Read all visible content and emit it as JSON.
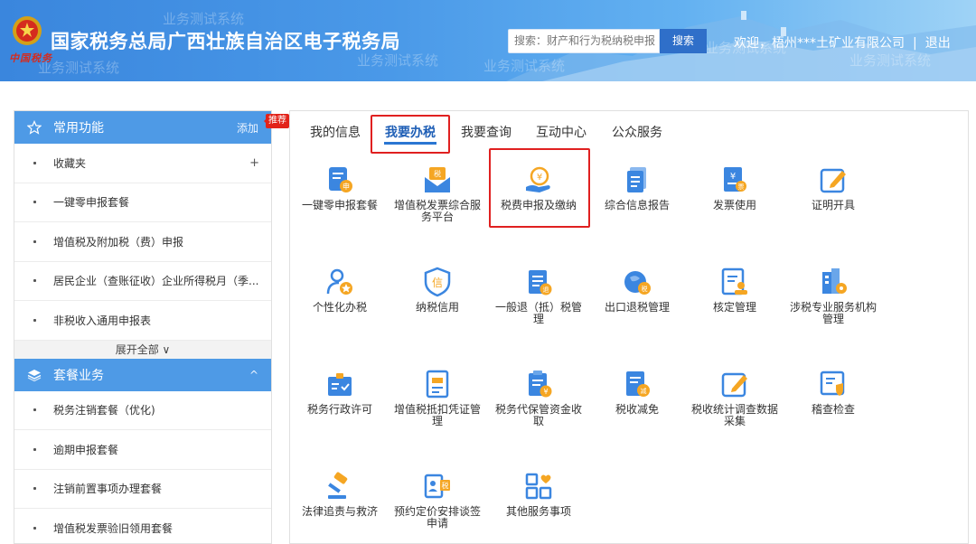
{
  "header": {
    "site_title": "国家税务总局广西壮族自治区电子税务局",
    "brand_sub": "中国税务",
    "watermark": "业务测试系统",
    "search_placeholder": "搜索：财产和行为税纳税申报",
    "search_button": "搜索",
    "welcome": "欢迎，",
    "company": "梧州***土矿业有限公司",
    "separator": "|",
    "logout": "退出"
  },
  "sidebar": {
    "common": {
      "title": "常用功能",
      "action": "添加",
      "badge": "推荐",
      "items": [
        {
          "label": "收藏夹",
          "extra": "+"
        },
        {
          "label": "一键零申报套餐"
        },
        {
          "label": "增值税及附加税（费）申报"
        },
        {
          "label": "居民企业（查账征收）企业所得税月（季..."
        },
        {
          "label": "非税收入通用申报表"
        }
      ],
      "expand": "展开全部 ∨"
    },
    "packages": {
      "title": "套餐业务",
      "collapse": "^",
      "items": [
        {
          "label": "税务注销套餐（优化)"
        },
        {
          "label": "逾期申报套餐"
        },
        {
          "label": "注销前置事项办理套餐"
        },
        {
          "label": "增值税发票验旧领用套餐"
        }
      ]
    }
  },
  "tabs": [
    "我的信息",
    "我要办税",
    "我要查询",
    "互动中心",
    "公众服务"
  ],
  "active_tab": "我要办税",
  "tiles": [
    {
      "label": "一键零申报套餐",
      "icon": "zero-declare-icon"
    },
    {
      "label": "增值税发票综合服务平台",
      "icon": "vat-invoice-platform-icon"
    },
    {
      "label": "税费申报及缴纳",
      "icon": "tax-declare-pay-icon"
    },
    {
      "label": "综合信息报告",
      "icon": "info-report-icon"
    },
    {
      "label": "发票使用",
      "icon": "invoice-use-icon"
    },
    {
      "label": "证明开具",
      "icon": "certificate-issue-icon"
    },
    {
      "label": "个性化办税",
      "icon": "personalized-icon"
    },
    {
      "label": "纳税信用",
      "icon": "tax-credit-icon"
    },
    {
      "label": "一般退（抵）税管理",
      "icon": "refund-management-icon"
    },
    {
      "label": "出口退税管理",
      "icon": "export-refund-icon"
    },
    {
      "label": "核定管理",
      "icon": "assessment-icon"
    },
    {
      "label": "涉税专业服务机构管理",
      "icon": "service-agency-icon"
    },
    {
      "label": "税务行政许可",
      "icon": "admin-permit-icon"
    },
    {
      "label": "增值税抵扣凭证管理",
      "icon": "deduction-voucher-icon"
    },
    {
      "label": "税务代保管资金收取",
      "icon": "custody-fund-icon"
    },
    {
      "label": "税收减免",
      "icon": "tax-reduction-icon"
    },
    {
      "label": "税收统计调查数据采集",
      "icon": "statistics-survey-icon"
    },
    {
      "label": "稽查检查",
      "icon": "inspection-icon"
    },
    {
      "label": "法律追责与救济",
      "icon": "legal-relief-icon"
    },
    {
      "label": "预约定价安排谈签申请",
      "icon": "pricing-arrangement-icon"
    },
    {
      "label": "其他服务事项",
      "icon": "other-services-icon"
    }
  ],
  "highlighted_tile": "税费申报及缴纳",
  "colors": {
    "header_blue": "#4a99e8",
    "sidebar_head": "#4e9ae6",
    "icon_blue": "#3b86e0",
    "icon_orange": "#f5a623",
    "highlight_red": "#e02020",
    "active_tab_text": "#1f5fb6"
  }
}
